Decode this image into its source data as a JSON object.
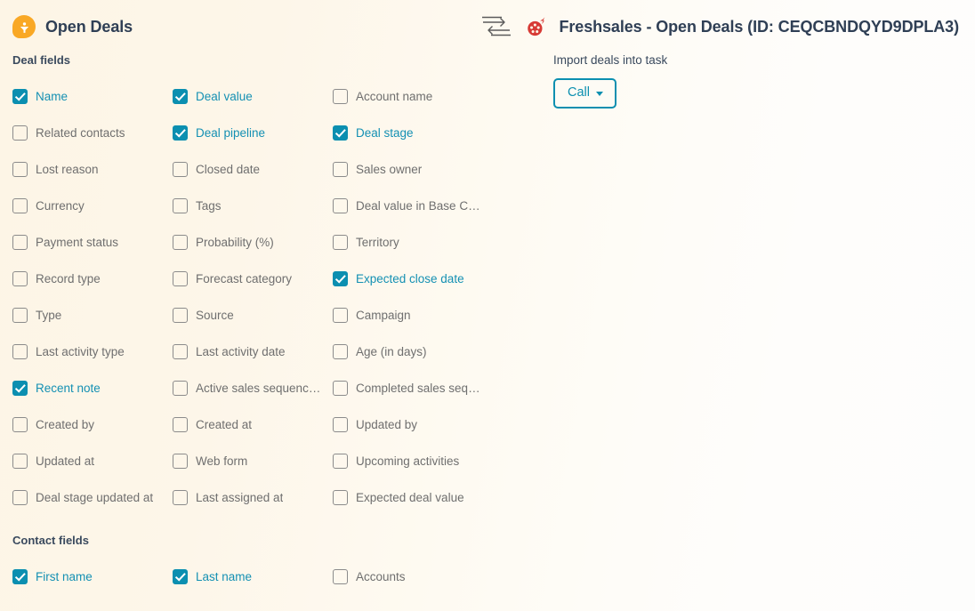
{
  "header": {
    "left_icon": "filter-badge-icon",
    "left_title": "Open Deals",
    "sync_icon": "sync-arrows-icon",
    "app_logo_icon": "freshsales-logo-icon",
    "right_title": "Freshsales - Open Deals (ID: CEQCBNDQYD9DPLA3)"
  },
  "deal_fields": {
    "section_label": "Deal fields",
    "items": [
      {
        "label": "Name",
        "checked": true
      },
      {
        "label": "Deal value",
        "checked": true
      },
      {
        "label": "Account name",
        "checked": false
      },
      {
        "label": "Related contacts",
        "checked": false
      },
      {
        "label": "Deal pipeline",
        "checked": true
      },
      {
        "label": "Deal stage",
        "checked": true
      },
      {
        "label": "Lost reason",
        "checked": false
      },
      {
        "label": "Closed date",
        "checked": false
      },
      {
        "label": "Sales owner",
        "checked": false
      },
      {
        "label": "Currency",
        "checked": false
      },
      {
        "label": "Tags",
        "checked": false
      },
      {
        "label": "Deal value in Base C…",
        "checked": false
      },
      {
        "label": "Payment status",
        "checked": false
      },
      {
        "label": "Probability (%)",
        "checked": false
      },
      {
        "label": "Territory",
        "checked": false
      },
      {
        "label": "Record type",
        "checked": false
      },
      {
        "label": "Forecast category",
        "checked": false
      },
      {
        "label": "Expected close date",
        "checked": true
      },
      {
        "label": "Type",
        "checked": false
      },
      {
        "label": "Source",
        "checked": false
      },
      {
        "label": "Campaign",
        "checked": false
      },
      {
        "label": "Last activity type",
        "checked": false
      },
      {
        "label": "Last activity date",
        "checked": false
      },
      {
        "label": "Age (in days)",
        "checked": false
      },
      {
        "label": "Recent note",
        "checked": true
      },
      {
        "label": "Active sales sequenc…",
        "checked": false
      },
      {
        "label": "Completed sales seq…",
        "checked": false
      },
      {
        "label": "Created by",
        "checked": false
      },
      {
        "label": "Created at",
        "checked": false
      },
      {
        "label": "Updated by",
        "checked": false
      },
      {
        "label": "Updated at",
        "checked": false
      },
      {
        "label": "Web form",
        "checked": false
      },
      {
        "label": "Upcoming activities",
        "checked": false
      },
      {
        "label": "Deal stage updated at",
        "checked": false
      },
      {
        "label": "Last assigned at",
        "checked": false
      },
      {
        "label": "Expected deal value",
        "checked": false
      }
    ]
  },
  "contact_fields": {
    "section_label": "Contact fields",
    "items": [
      {
        "label": "First name",
        "checked": true
      },
      {
        "label": "Last name",
        "checked": true
      },
      {
        "label": "Accounts",
        "checked": false
      }
    ]
  },
  "import_panel": {
    "label": "Import deals into task",
    "button_label": "Call",
    "caret_icon": "chevron-down-icon"
  },
  "colors": {
    "accent_teal": "#0b8fb0",
    "badge_orange": "#f9a825",
    "logo_red": "#d73a35",
    "heading": "#2f3f55",
    "background_cream": "#fdf5e6"
  }
}
